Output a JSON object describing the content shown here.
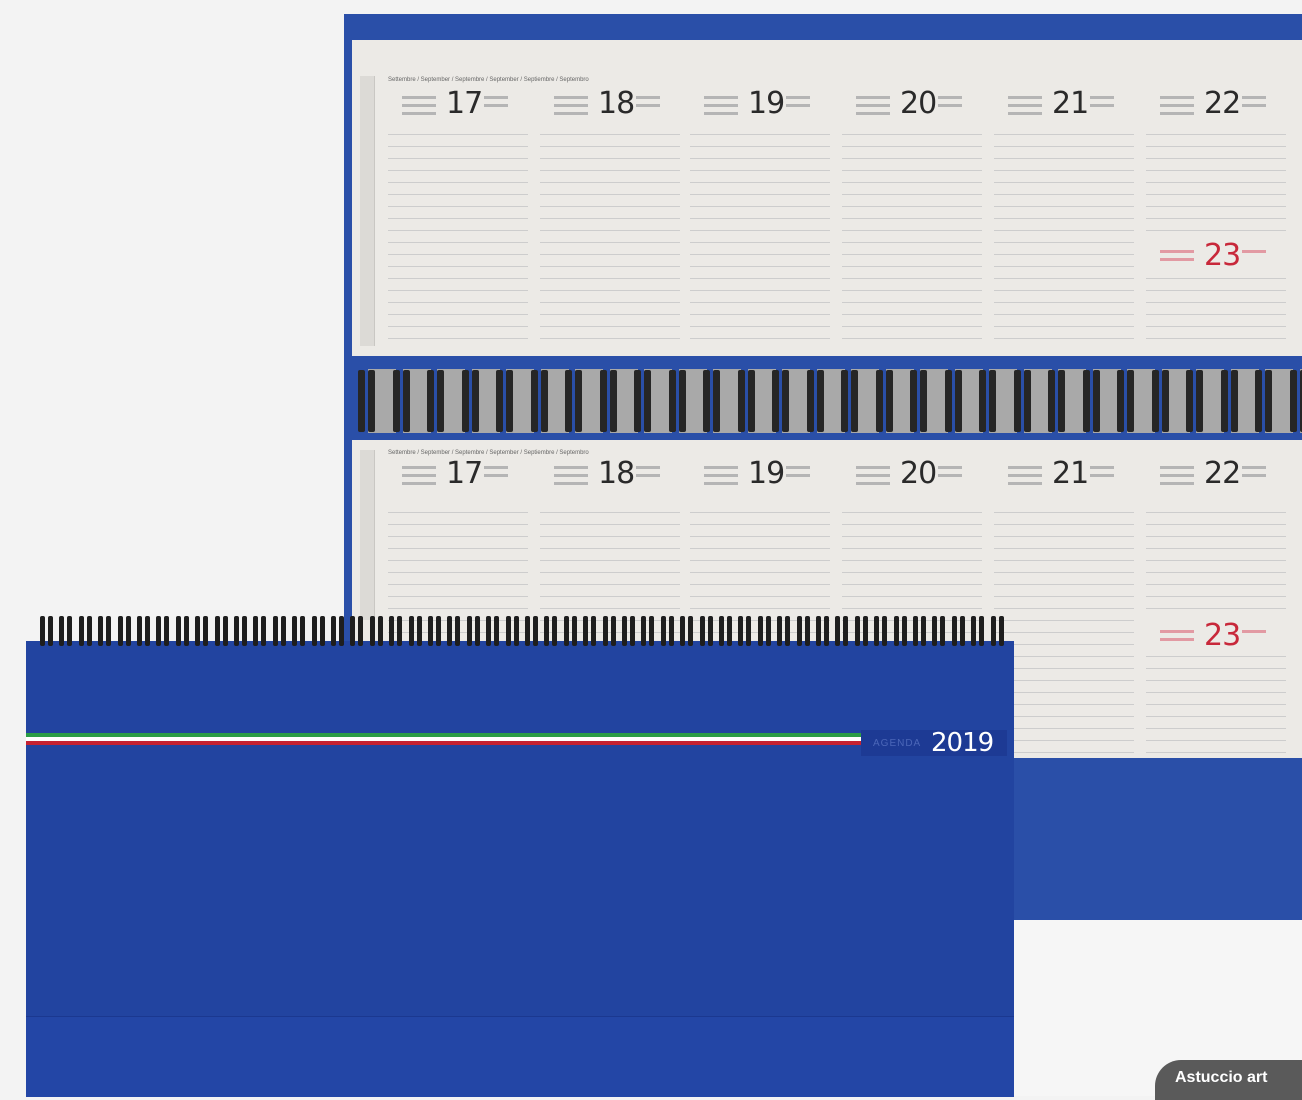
{
  "upper_planner": {
    "days": [
      {
        "number": "17"
      },
      {
        "number": "18"
      },
      {
        "number": "19"
      },
      {
        "number": "20"
      },
      {
        "number": "21"
      },
      {
        "number": "22"
      }
    ],
    "sunday": {
      "number": "23"
    }
  },
  "lower_planner": {
    "days": [
      {
        "number": "17"
      },
      {
        "number": "18"
      },
      {
        "number": "19"
      },
      {
        "number": "20"
      },
      {
        "number": "21"
      },
      {
        "number": "22"
      }
    ],
    "sunday": {
      "number": "23"
    }
  },
  "cover": {
    "brand_small": "AGENDA",
    "year": "2019"
  },
  "badge": {
    "label": "Astuccio art"
  },
  "colors": {
    "cover_blue": "#2244a0",
    "sunday_red": "#c8283a",
    "flag_green": "#2b9d46",
    "flag_red": "#c42233"
  }
}
